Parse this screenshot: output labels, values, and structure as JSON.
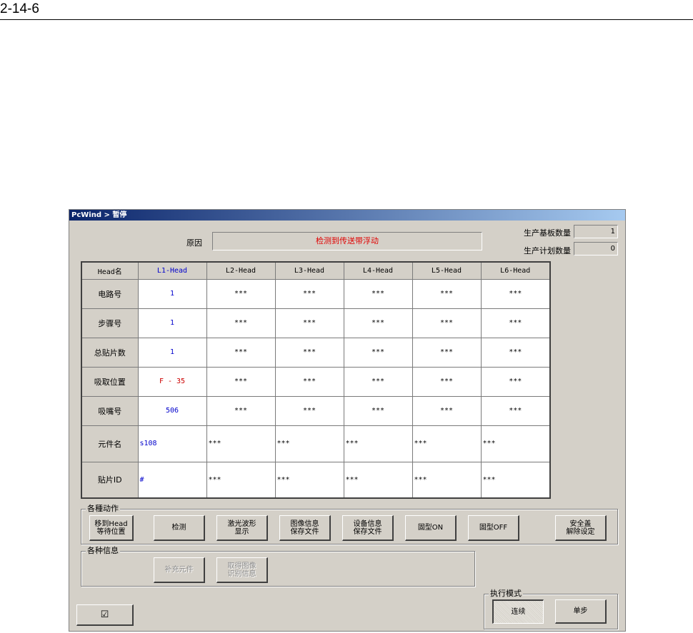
{
  "page": {
    "number": "2-14-6"
  },
  "window": {
    "title": "PcWind > 暂停"
  },
  "reason": {
    "label": "原因",
    "value": "检测到传送带浮动"
  },
  "counts": {
    "produced_label": "生产基板数量",
    "produced_value": "1",
    "planned_label": "生产计划数量",
    "planned_value": "0"
  },
  "table": {
    "corner": "Head名",
    "columns": [
      "L1-Head",
      "L2-Head",
      "L3-Head",
      "L4-Head",
      "L5-Head",
      "L6-Head"
    ],
    "rows": [
      {
        "label": "电路号",
        "cells": [
          "1",
          "***",
          "***",
          "***",
          "***",
          "***"
        ]
      },
      {
        "label": "步骤号",
        "cells": [
          "1",
          "***",
          "***",
          "***",
          "***",
          "***"
        ]
      },
      {
        "label": "总贴片数",
        "cells": [
          "1",
          "***",
          "***",
          "***",
          "***",
          "***"
        ]
      },
      {
        "label": "吸取位置",
        "cells": [
          "F - 35",
          "***",
          "***",
          "***",
          "***",
          "***"
        ]
      },
      {
        "label": "吸嘴号",
        "cells": [
          "506",
          "***",
          "***",
          "***",
          "***",
          "***"
        ]
      },
      {
        "label": "元件名",
        "cells": [
          "s108",
          "***",
          "***",
          "***",
          "***",
          "***"
        ]
      },
      {
        "label": "贴片ID",
        "cells": [
          "#",
          "***",
          "***",
          "***",
          "***",
          "***"
        ]
      }
    ]
  },
  "actions": {
    "title": "各種动作",
    "move_head": "移到Head\n等待位置",
    "detect": "检测",
    "laser": "激光波形\n显示",
    "image_save": "图像信息\n保存文件",
    "device_save": "设备信息\n保存文件",
    "clamp_on": "固型ON",
    "clamp_off": "固型OFF",
    "safety": "安全盖\n解除设定"
  },
  "info": {
    "title": "各种信息",
    "supplement": "补充元件",
    "get_image": "取得图像\n识别信息"
  },
  "mode": {
    "title": "执行模式",
    "continuous": "连续",
    "step": "单步"
  },
  "icons": {
    "ok_button": "checkbox-icon"
  }
}
